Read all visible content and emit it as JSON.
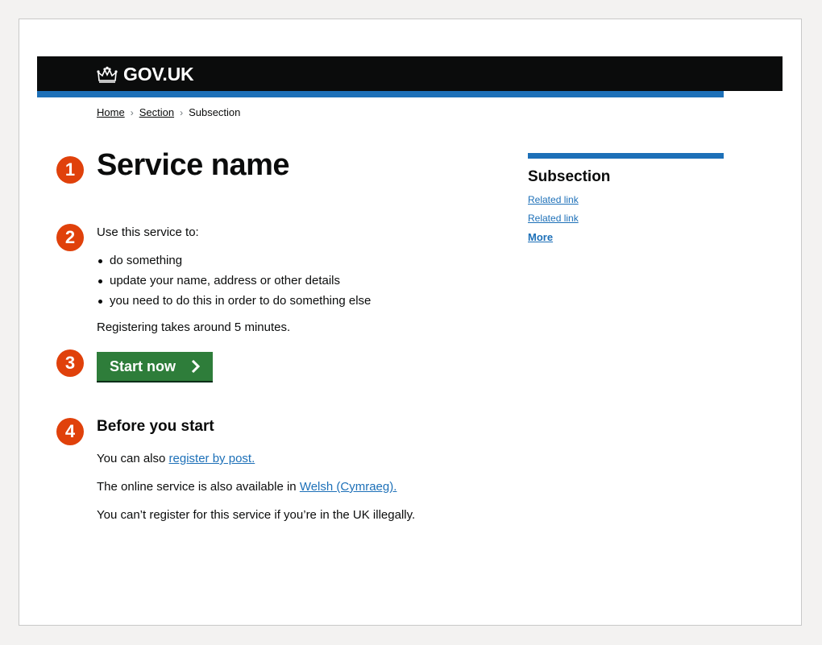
{
  "header": {
    "logo_text": "GOV.UK",
    "logo_icon": "crown-icon",
    "background": "#0b0c0c",
    "accent": "#1d70b8"
  },
  "breadcrumb": {
    "items": [
      "Home",
      "Section"
    ],
    "current": "Subsection"
  },
  "steps": [
    "1",
    "2",
    "3",
    "4"
  ],
  "main": {
    "title": "Service name",
    "intro": "Use this service to:",
    "bullets": [
      "do something",
      "update your name, address or other details",
      "you need to do this in order to do something else"
    ],
    "duration": "Registering takes around 5 minutes.",
    "start_button_label": "Start now",
    "start_button_color": "#2e7d3a"
  },
  "before": {
    "heading": "Before you start",
    "line1_prefix": "You can also ",
    "line1_link": "register by post.",
    "line2_prefix": "The online service is also available in ",
    "line2_link": "Welsh (Cymraeg).",
    "line3": "You can’t register for this service if you’re in the UK illegally."
  },
  "sidebar": {
    "title": "Subsection",
    "links": [
      "Related link",
      "Related link"
    ],
    "more": "More"
  },
  "badge_color": "#e0410b"
}
